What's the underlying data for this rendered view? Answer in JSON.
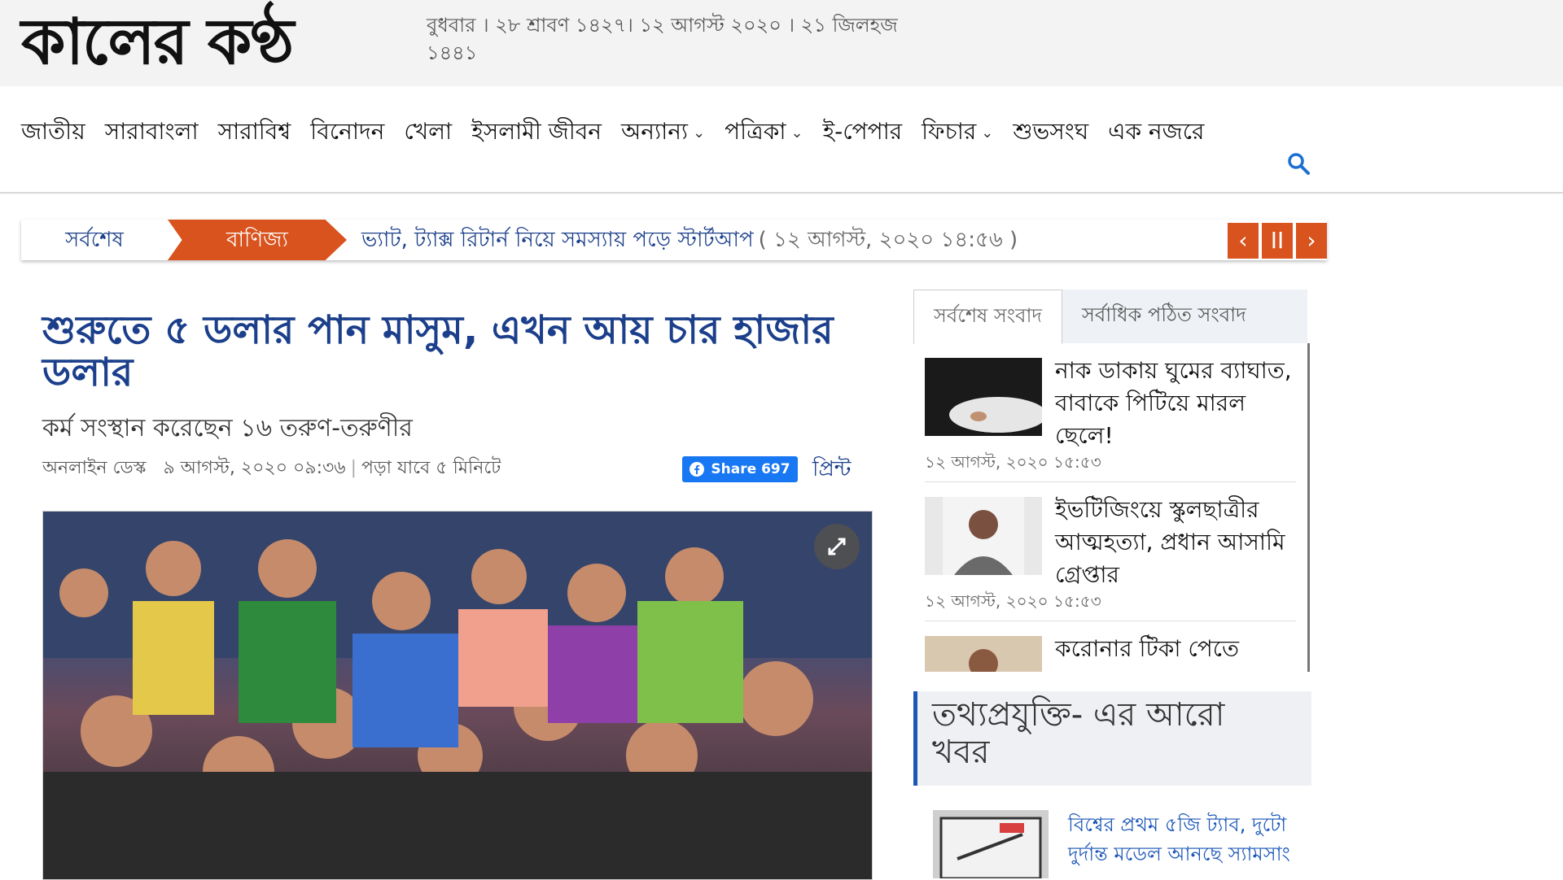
{
  "header": {
    "logo_text": "কালের কণ্ঠ",
    "dateline": "বুধবার । ২৮ শ্রাবণ ১৪২৭। ১২ আগস্ট ২০২০ । ২১ জিলহজ ১৪৪১"
  },
  "nav": {
    "items": [
      {
        "label": "জাতীয়"
      },
      {
        "label": "সারাবাংলা"
      },
      {
        "label": "সারাবিশ্ব"
      },
      {
        "label": "বিনোদন"
      },
      {
        "label": "খেলা"
      },
      {
        "label": "ইসলামী জীবন"
      },
      {
        "label": "অন্যান্য"
      },
      {
        "label": "পত্রিকা"
      },
      {
        "label": "ই-পেপার"
      },
      {
        "label": "ফিচার"
      },
      {
        "label": "শুভসংঘ"
      },
      {
        "label": "এক নজরে"
      }
    ]
  },
  "ticker": {
    "label": "সর্বশেষ",
    "category": "বাণিজ্য",
    "headline": "ভ্যাট, ট্যাক্স রিটার্ন নিয়ে সমস্যায় পড়ে স্টার্টআপ",
    "time": "( ১২ আগস্ট, ২০২০ ১৪:৫৬ )",
    "prev": "‹",
    "pause": "II",
    "next": "›"
  },
  "article": {
    "title": "শুরুতে ৫ ডলার পান মাসুম, এখন আয় চার হাজার ডলার",
    "subtitle": "কর্ম সংস্থান করেছেন ১৬ তরুণ-তরুণীর",
    "author": "অনলাইন ডেস্ক",
    "published": "৯ আগস্ট, ২০২০ ০৯:৩৬",
    "read_time": "পড়া যাবে ৫ মিনিটে",
    "share_label": "Share 697",
    "print_label": "প্রিন্ট"
  },
  "sidebar": {
    "tabs": [
      {
        "label": "সর্বশেষ সংবাদ"
      },
      {
        "label": "সর্বাধিক পঠিত সংবাদ"
      }
    ],
    "news": [
      {
        "title": "নাক ডাকায় ঘুমের ব্যাঘাত, বাবাকে পিটিয়ে মারল ছেলে!",
        "time": "১২ আগস্ট, ২০২০ ১৫:৫৩"
      },
      {
        "title": "ইভটিজিংয়ে স্কুলছাত্রীর আত্মহত্যা, প্রধান আসামি গ্রেপ্তার",
        "time": "১২ আগস্ট, ২০২০ ১৫:৫৩"
      },
      {
        "title": "করোনার টিকা পেতে",
        "time": ""
      }
    ],
    "more_title": "তথ্যপ্রযুক্তি- এর আরো খবর",
    "more_item": "বিশ্বের প্রথম ৫জি ট্যাব, দুটো দুর্দান্ত মডেল আনছে স্যামসাং"
  }
}
